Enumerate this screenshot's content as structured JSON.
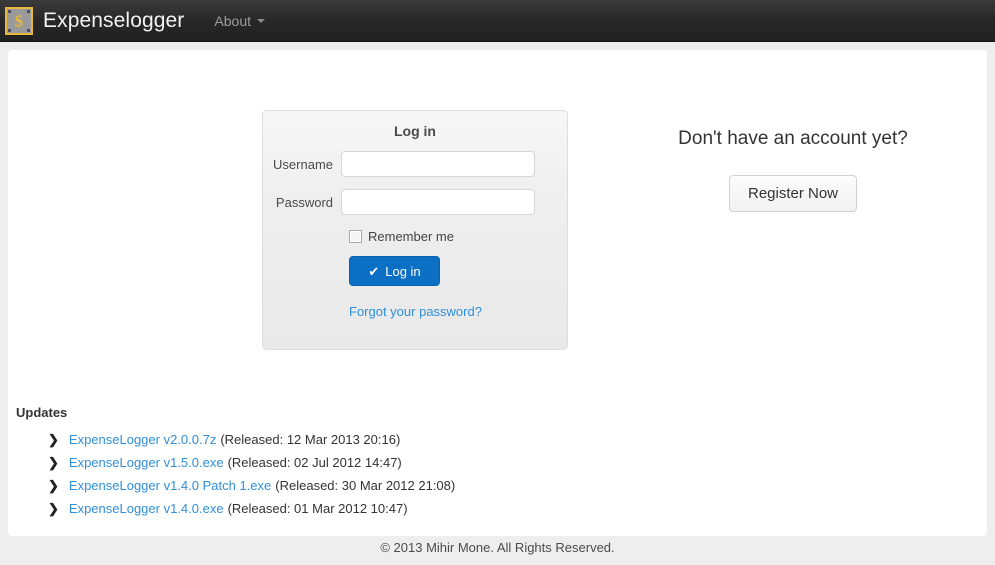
{
  "navbar": {
    "brand": "Expenselogger",
    "logo_icon": "dollar-bill-icon",
    "logo_glyph": "$",
    "about_label": "About",
    "caret_icon": "chevron-down-icon",
    "background_color": "#272727"
  },
  "login": {
    "title": "Log in",
    "username_label": "Username",
    "username_value": "",
    "username_placeholder": "",
    "password_label": "Password",
    "password_value": "",
    "password_placeholder": "",
    "remember_label": "Remember me",
    "remember_checked": false,
    "submit_label": "Log in",
    "submit_icon": "check-icon",
    "submit_glyph": "✔",
    "submit_color": "#0b6fc4",
    "forgot_label": "Forgot your password?",
    "link_color": "#2f8fd8"
  },
  "register": {
    "heading": "Don't have an account yet?",
    "button_label": "Register Now"
  },
  "updates": {
    "title": "Updates",
    "marker_icon": "chevron-right-icon",
    "marker_glyph": "❯",
    "items": [
      {
        "name": "ExpenseLogger v2.0.0.7z",
        "meta": "(Released: 12 Mar 2013 20:16)"
      },
      {
        "name": "ExpenseLogger v1.5.0.exe",
        "meta": "(Released: 02 Jul 2012 14:47)"
      },
      {
        "name": "ExpenseLogger v1.4.0 Patch 1.exe",
        "meta": "(Released: 30 Mar 2012 21:08)"
      },
      {
        "name": "ExpenseLogger v1.4.0.exe",
        "meta": "(Released: 01 Mar 2012 10:47)"
      }
    ]
  },
  "footer": {
    "copyright": "© 2013 Mihir Mone. All Rights Reserved."
  }
}
